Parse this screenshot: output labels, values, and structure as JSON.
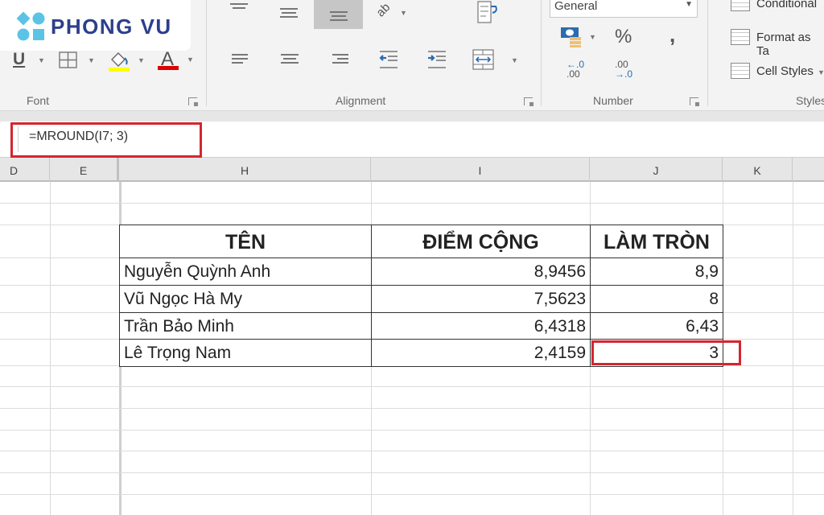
{
  "logo": {
    "text": "PHONG VU",
    "icon": "phong-vu-logo-mark",
    "colors": {
      "mark": "#5bc4e6",
      "text": "#2d3f8c"
    }
  },
  "ribbon": {
    "font_group": {
      "label": "Font",
      "buttons": [
        {
          "name": "underline",
          "glyph": "U",
          "icon": "underline-icon"
        },
        {
          "name": "borders",
          "icon": "borders-icon"
        },
        {
          "name": "fill-color",
          "icon": "fill-color-icon",
          "color": "#ffff00"
        },
        {
          "name": "font-color",
          "glyph": "A",
          "icon": "font-color-icon",
          "color": "#e00000"
        }
      ]
    },
    "alignment_group": {
      "label": "Alignment",
      "buttons": [
        {
          "name": "top-align",
          "icon": "top-align-icon"
        },
        {
          "name": "middle-align",
          "icon": "middle-align-icon"
        },
        {
          "name": "bottom-align",
          "icon": "bottom-align-icon",
          "selected": true
        },
        {
          "name": "orientation",
          "glyph": "ab",
          "icon": "orientation-icon"
        },
        {
          "name": "wrap-text",
          "icon": "wrap-text-icon"
        },
        {
          "name": "align-left",
          "icon": "align-left-icon"
        },
        {
          "name": "center",
          "icon": "align-center-icon"
        },
        {
          "name": "align-right",
          "icon": "align-right-icon"
        },
        {
          "name": "decrease-indent",
          "icon": "decrease-indent-icon"
        },
        {
          "name": "increase-indent",
          "icon": "increase-indent-icon"
        },
        {
          "name": "merge-center",
          "icon": "merge-center-icon"
        }
      ]
    },
    "number_group": {
      "label": "Number",
      "format_value": "General",
      "percent": "%",
      "comma": ",",
      "increase_decimal": {
        "top": "←.0",
        "bottom": ".00"
      },
      "decrease_decimal": {
        "top": ".00",
        "bottom": "→.0"
      }
    },
    "styles_group": {
      "label": "Styles",
      "items": [
        "Conditional",
        "Format as Ta",
        "Cell Styles"
      ]
    }
  },
  "formula_bar": {
    "value": "=MROUND(I7; 3)"
  },
  "columns": [
    "D",
    "E",
    "H",
    "I",
    "J",
    "K"
  ],
  "table": {
    "headers": [
      "TÊN",
      "ĐIỂM CỘNG",
      "LÀM TRÒN"
    ],
    "rows": [
      {
        "name": "Nguyễn Quỳnh Anh",
        "score": "8,9456",
        "rounded": "8,9"
      },
      {
        "name": "Vũ Ngọc Hà My",
        "score": "7,5623",
        "rounded": "8"
      },
      {
        "name": "Trần Bảo Minh",
        "score": "6,4318",
        "rounded": "6,43"
      },
      {
        "name": "Lê Trọng Nam",
        "score": "2,4159",
        "rounded": "3"
      }
    ]
  },
  "highlight_color": "#d3262e"
}
